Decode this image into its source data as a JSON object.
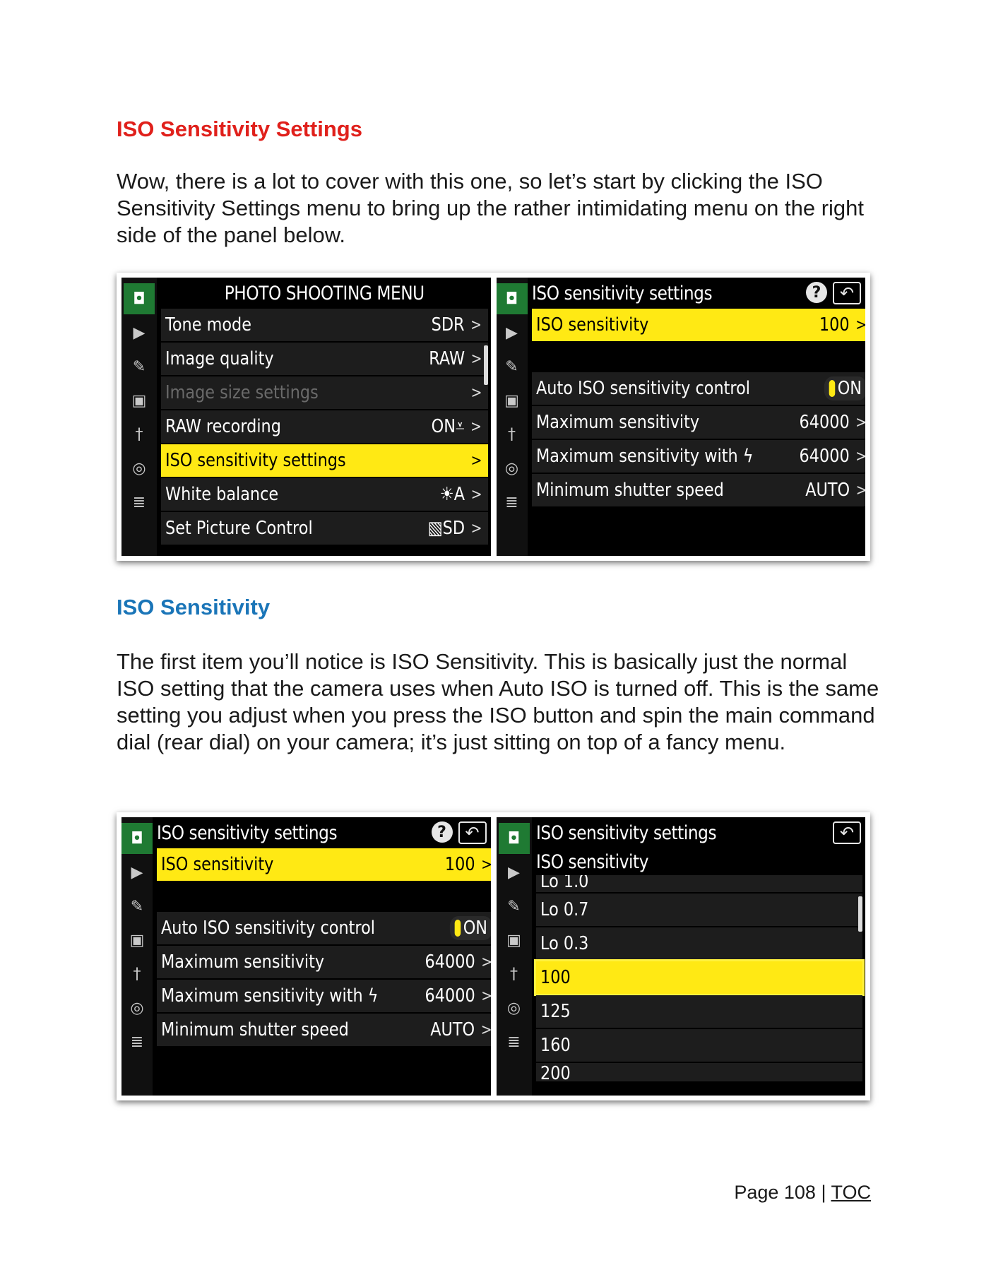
{
  "section1": {
    "heading": "ISO Sensitivity Settings",
    "paragraph": "Wow, there is a lot to cover with this one, so let’s start by clicking the ISO Sensitivity Settings menu to bring up the rather intimidating menu on the right side of the panel below."
  },
  "section2": {
    "heading": "ISO Sensitivity",
    "paragraph": "The first item you’ll notice is ISO Sensitivity. This is basically just the normal ISO setting that the camera uses when Auto ISO is turned off. This is the same setting you adjust when you press the ISO button and spin the main command dial (rear dial) on your camera; it’s just sitting on top of a fancy menu."
  },
  "photo_menu": {
    "title": "PHOTO SHOOTING MENU",
    "rows": [
      {
        "label": "Tone mode",
        "value": "SDR"
      },
      {
        "label": "Image quality",
        "value": "RAW"
      },
      {
        "label": "Image size settings",
        "value": ""
      },
      {
        "label": "RAW recording",
        "value": "ON⩡"
      },
      {
        "label": "ISO sensitivity settings",
        "value": ""
      },
      {
        "label": "White balance",
        "value": "☀A"
      },
      {
        "label": "Set Picture Control",
        "value": "▧SD"
      }
    ]
  },
  "iso_settings_menu": {
    "title": "ISO sensitivity settings",
    "help_icon": "?",
    "back_icon": "↶",
    "iso_row": {
      "label": "ISO sensitivity",
      "value": "100"
    },
    "auto_row": {
      "label": "Auto ISO sensitivity control",
      "value": "ON"
    },
    "max_row": {
      "label": "Maximum sensitivity",
      "value": "64000"
    },
    "max_flash_row": {
      "label": "Maximum sensitivity with ϟ",
      "value": "64000"
    },
    "min_shutter_row": {
      "label": "Minimum shutter speed",
      "value": "AUTO"
    }
  },
  "iso_list_menu": {
    "title": "ISO sensitivity settings",
    "subtitle": "ISO sensitivity",
    "items": [
      "Lo 1.0",
      "Lo 0.7",
      "Lo 0.3",
      "100",
      "125",
      "160",
      "200"
    ],
    "selected": "100"
  },
  "rail_icons": [
    "camera-icon",
    "movie-icon",
    "pencil-icon",
    "playback-icon",
    "wrench-icon",
    "network-icon",
    "mymenu-icon"
  ],
  "rail_glyphs": [
    "◘",
    "▶",
    "✎",
    "▣",
    "†",
    "◎",
    "≣"
  ],
  "chevron": ">",
  "footer": {
    "page": "Page 108 | ",
    "toc": "TOC"
  }
}
